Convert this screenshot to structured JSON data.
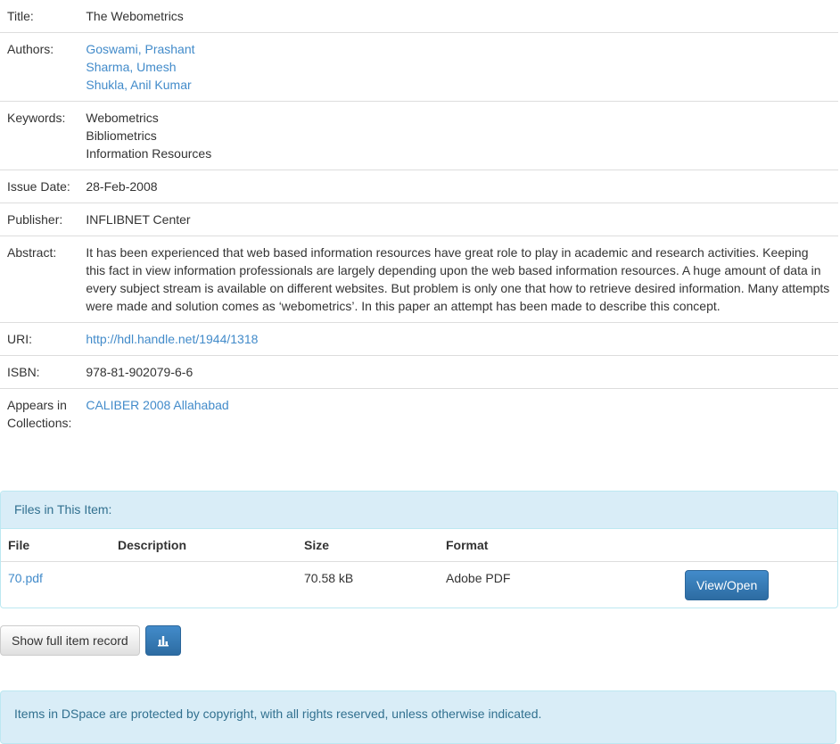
{
  "metadata": {
    "title": {
      "label": "Title:",
      "value": "The Webometrics"
    },
    "authors": {
      "label": "Authors:",
      "values": [
        "Goswami, Prashant",
        "Sharma, Umesh",
        "Shukla, Anil Kumar"
      ]
    },
    "keywords": {
      "label": "Keywords:",
      "values": [
        "Webometrics",
        "Bibliometrics",
        "Information Resources"
      ]
    },
    "issue_date": {
      "label": "Issue Date:",
      "value": "28-Feb-2008"
    },
    "publisher": {
      "label": "Publisher:",
      "value": "INFLIBNET Center"
    },
    "abstract": {
      "label": "Abstract:",
      "value": "It has been experienced that web based information resources have great role to play in academic and research activities. Keeping this fact in view information professionals are largely depending upon the web based information resources. A huge amount of data in every subject stream is available on different websites. But problem is only one that how to retrieve desired information. Many attempts were made and solution comes as ‘webometrics’. In this paper an attempt has been made to describe this concept."
    },
    "uri": {
      "label": "URI:",
      "value": "http://hdl.handle.net/1944/1318"
    },
    "isbn": {
      "label": "ISBN:",
      "value": "978-81-902079-6-6"
    },
    "collections": {
      "label": "Appears in Collections:",
      "value": "CALIBER 2008 Allahabad"
    }
  },
  "files_panel": {
    "heading": "Files in This Item:",
    "columns": [
      "File",
      "Description",
      "Size",
      "Format"
    ],
    "rows": [
      {
        "file": "70.pdf",
        "description": "",
        "size": "70.58 kB",
        "format": "Adobe PDF",
        "action": "View/Open"
      }
    ]
  },
  "actions": {
    "full_record_label": "Show full item record",
    "stats_icon": "bar-chart-icon"
  },
  "footer": {
    "notice": "Items in DSpace are protected by copyright, with all rights reserved, unless otherwise indicated."
  },
  "colors": {
    "link": "#428bca",
    "primary": "#337ab7",
    "panel_bg": "#d9edf7",
    "panel_text": "#31708f"
  }
}
